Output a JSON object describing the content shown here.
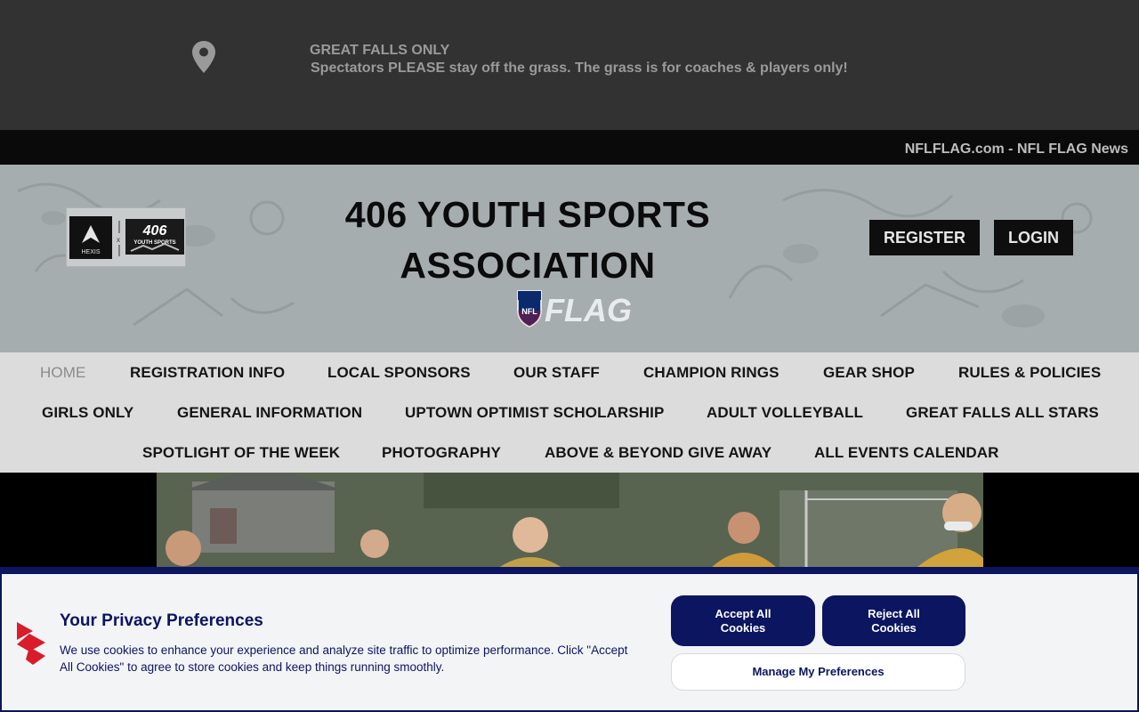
{
  "alert": {
    "icon": "map-pin-icon",
    "title": "GREAT FALLS ONLY",
    "message": "Spectators PLEASE stay off the grass. The grass is for coaches & players only!"
  },
  "news": {
    "link1": "NFLFLAG.com",
    "separator": "-",
    "link2": "NFL FLAG News"
  },
  "header": {
    "title": "406 YOUTH SPORTS ASSOCIATION",
    "logo_left_text": "HEXIS",
    "logo_right_text": "406",
    "logo_right_sub": "YOUTH SPORTS",
    "flag_logo_text": "FLAG",
    "shield_text": "NFL",
    "register_label": "REGISTER",
    "login_label": "LOGIN"
  },
  "nav": {
    "items": [
      "HOME",
      "REGISTRATION INFO",
      "LOCAL SPONSORS",
      "OUR STAFF",
      "CHAMPION RINGS",
      "GEAR SHOP",
      "RULES & POLICIES",
      "GIRLS ONLY",
      "GENERAL INFORMATION",
      "UPTOWN OPTIMIST SCHOLARSHIP",
      "ADULT VOLLEYBALL",
      "GREAT FALLS ALL STARS",
      "SPOTLIGHT OF THE WEEK",
      "PHOTOGRAPHY",
      "ABOVE & BEYOND GIVE AWAY",
      "ALL EVENTS CALENDAR"
    ],
    "active": "HOME"
  },
  "cookie": {
    "title": "Your Privacy Preferences",
    "text": "We use cookies to enhance your experience and analyze site traffic to optimize performance. Click \"Accept All Cookies\" to agree to store cookies and keep things running smoothly.",
    "accept_label_1": "Accept All",
    "accept_label_2": "Cookies",
    "reject_label_1": "Reject All",
    "reject_label_2": "Cookies",
    "manage_label": "Manage My Preferences"
  },
  "colors": {
    "alert_bg": "#323232",
    "news_bg": "#0a0a0a",
    "nav_bg": "#dcdcdc",
    "cookie_accent": "#0b1560"
  }
}
